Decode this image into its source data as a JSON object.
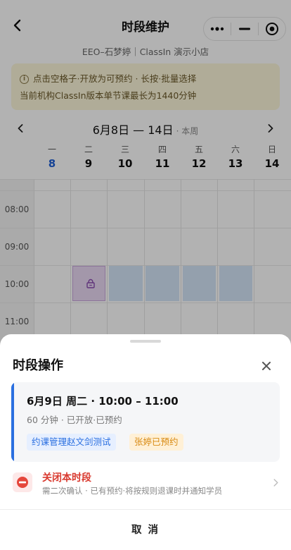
{
  "app": {
    "title": "时段维护",
    "subtitle": "EEO–石梦婷｜ClassIn 演示小店"
  },
  "capsule": {
    "more_icon": "ellipsis-icon",
    "minimize_icon": "minus-icon",
    "close_icon": "target-circle-icon"
  },
  "notice": {
    "line1": "点击空格子·开放为可预约 · 长按·批量选择",
    "line2": "当前机构ClassIn版本单节课最长为1440分钟"
  },
  "week": {
    "range": "6月8日 — 14日",
    "current_label": "· 本周"
  },
  "days": [
    {
      "weekday": "一",
      "date": "8",
      "today": true
    },
    {
      "weekday": "二",
      "date": "9",
      "today": false
    },
    {
      "weekday": "三",
      "date": "10",
      "today": false
    },
    {
      "weekday": "四",
      "date": "11",
      "today": false
    },
    {
      "weekday": "五",
      "date": "12",
      "today": false
    },
    {
      "weekday": "六",
      "date": "13",
      "today": false
    },
    {
      "weekday": "日",
      "date": "14",
      "today": false
    }
  ],
  "times": [
    "08:00",
    "09:00",
    "10:00",
    "11:00"
  ],
  "slots_10am": [
    {
      "day": "二",
      "state": "booked"
    },
    {
      "day": "三",
      "state": "open"
    },
    {
      "day": "四",
      "state": "open"
    },
    {
      "day": "五",
      "state": "open"
    },
    {
      "day": "六",
      "state": "open"
    }
  ],
  "sheet": {
    "title": "时段操作",
    "card": {
      "time": "6月9日 周二 · 10:00 – 11:00",
      "meta": "60 分钟 · 已开放·已预约",
      "tag_course": "约课管理赵文剑测试",
      "tag_booked": "张婷已预约"
    },
    "action": {
      "title": "关闭本时段",
      "desc": "需二次确认 · 已有预约·将按规则退课时并通知学员"
    },
    "cancel": "取 消"
  },
  "colors": {
    "accent": "#2a6fe0",
    "danger": "#d93a2f",
    "booked_tag": "#d88a12",
    "notice_bg": "#fdf6da"
  }
}
